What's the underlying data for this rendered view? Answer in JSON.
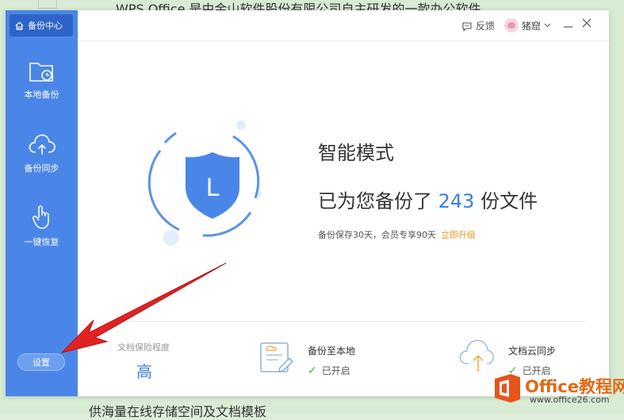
{
  "background": {
    "top_text": "WPS Office 是由金山软件股份有限公司自主研发的一款办公软件",
    "bottom_text": "供海量在线存储空间及文档模板"
  },
  "sidebar": {
    "brand": "备份中心",
    "items": [
      {
        "label": "本地备份",
        "icon": "folder-clock-icon"
      },
      {
        "label": "备份同步",
        "icon": "cloud-upload-icon"
      },
      {
        "label": "一键恢复",
        "icon": "hand-pointer-icon"
      }
    ],
    "settings": "设置"
  },
  "header": {
    "feedback": "反馈",
    "username": "猪窟"
  },
  "main": {
    "mode_title": "智能模式",
    "backup_prefix": "已为您备份了",
    "backup_count": "243",
    "backup_suffix": "份文件",
    "retain_text": "备份保存30天，会员专享90天",
    "upgrade_link": "立即升级",
    "shield_letter": "L"
  },
  "footer": {
    "insurance_label": "文档保险程度",
    "insurance_value": "高",
    "local_title": "备份至本地",
    "local_status": "已开启",
    "cloud_title": "文档云同步",
    "cloud_status": "已开启"
  },
  "watermark": {
    "title": "Office教程网",
    "url": "www.office26.com"
  },
  "colors": {
    "sidebar": "#4a86e8",
    "brand_bg": "#2e63c9",
    "accent": "#3a7ee0",
    "upgrade": "#f0962a",
    "arrow": "#e02222"
  }
}
